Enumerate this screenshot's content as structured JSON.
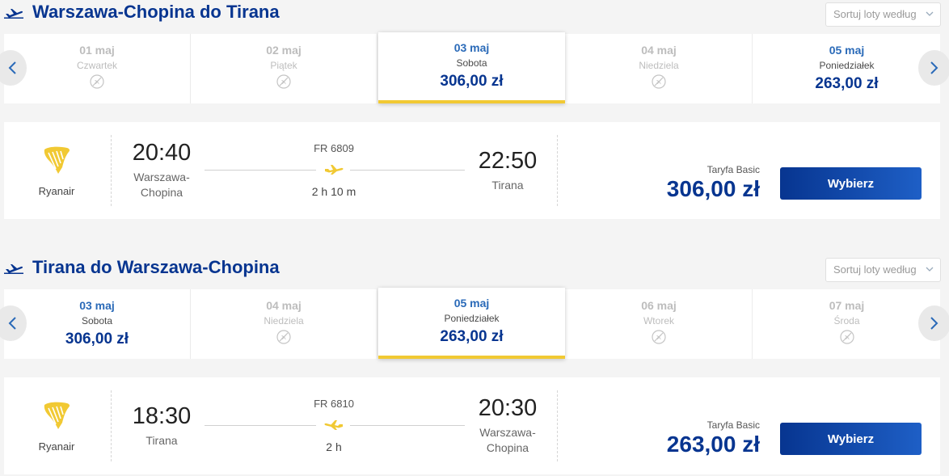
{
  "outbound": {
    "title": "Warszawa-Chopina do Tirana",
    "sort_placeholder": "Sortuj loty według",
    "dates": [
      {
        "date": "01 maj",
        "day": "Czwartek",
        "price": "",
        "state": "disabled"
      },
      {
        "date": "02 maj",
        "day": "Piątek",
        "price": "",
        "state": "disabled"
      },
      {
        "date": "03 maj",
        "day": "Sobota",
        "price": "306,00 zł",
        "state": "selected"
      },
      {
        "date": "04 maj",
        "day": "Niedziela",
        "price": "",
        "state": "disabled"
      },
      {
        "date": "05 maj",
        "day": "Poniedziałek",
        "price": "263,00 zł",
        "state": "avail"
      }
    ],
    "flight": {
      "airline": "Ryanair",
      "dep_time": "20:40",
      "dep_place": "Warszawa-\nChopina",
      "flight_no": "FR 6809",
      "duration": "2 h 10 m",
      "arr_time": "22:50",
      "arr_place": "Tirana",
      "fare_label": "Taryfa Basic",
      "price": "306,00 zł",
      "button": "Wybierz"
    }
  },
  "return": {
    "title": "Tirana do Warszawa-Chopina",
    "sort_placeholder": "Sortuj loty według",
    "dates": [
      {
        "date": "03 maj",
        "day": "Sobota",
        "price": "306,00 zł",
        "state": "avail"
      },
      {
        "date": "04 maj",
        "day": "Niedziela",
        "price": "",
        "state": "disabled"
      },
      {
        "date": "05 maj",
        "day": "Poniedziałek",
        "price": "263,00 zł",
        "state": "selected"
      },
      {
        "date": "06 maj",
        "day": "Wtorek",
        "price": "",
        "state": "disabled"
      },
      {
        "date": "07 maj",
        "day": "Środa",
        "price": "",
        "state": "disabled"
      }
    ],
    "flight": {
      "airline": "Ryanair",
      "dep_time": "18:30",
      "dep_place": "Tirana",
      "flight_no": "FR 6810",
      "duration": "2 h",
      "arr_time": "20:30",
      "arr_place": "Warszawa-\nChopina",
      "fare_label": "Taryfa Basic",
      "price": "263,00 zł",
      "button": "Wybierz"
    }
  },
  "colors": {
    "brand_blue": "#073590",
    "accent_yellow": "#f1c933",
    "plane_yellow": "#f1c933"
  },
  "icons": {
    "section_header": "plane-takeoff-icon",
    "no_flight": "no-flight-icon",
    "route": "plane-icon",
    "airline_logo": "ryanair-harp-logo",
    "prev": "chevron-left-icon",
    "next": "chevron-right-icon",
    "sort": "chevron-down-icon"
  }
}
